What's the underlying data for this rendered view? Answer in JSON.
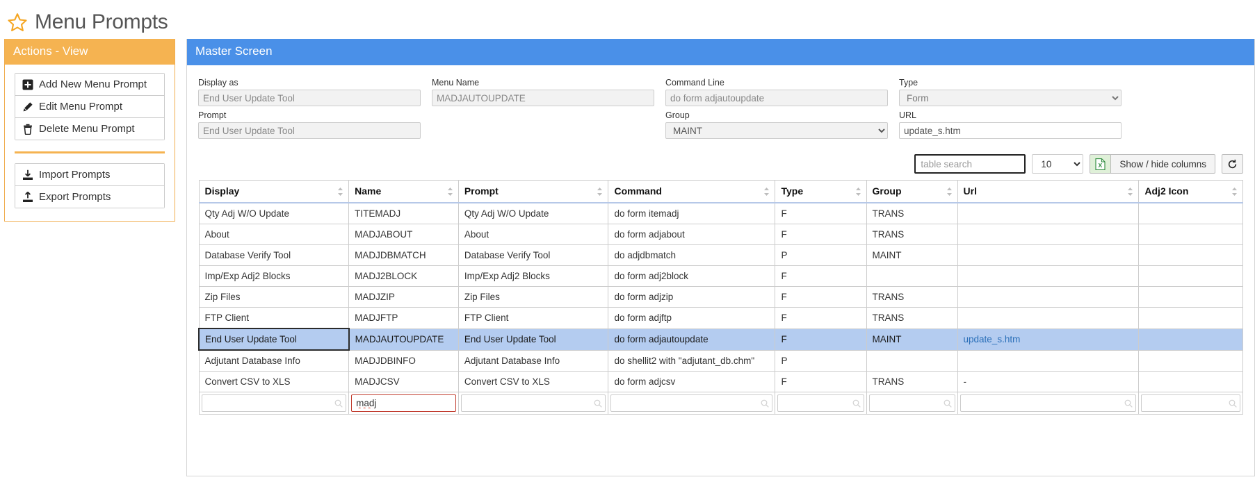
{
  "page": {
    "title": "Menu Prompts",
    "star_icon": "star-icon"
  },
  "sidebar": {
    "header": "Actions - View",
    "primary_buttons": [
      {
        "label": "Add New Menu Prompt",
        "icon": "plus-square-icon"
      },
      {
        "label": "Edit Menu Prompt",
        "icon": "pencil-icon"
      },
      {
        "label": "Delete Menu Prompt",
        "icon": "trash-icon"
      }
    ],
    "secondary_buttons": [
      {
        "label": "Import Prompts",
        "icon": "download-icon"
      },
      {
        "label": "Export Prompts",
        "icon": "upload-icon"
      }
    ]
  },
  "main": {
    "header": "Master Screen",
    "form": {
      "display_as": {
        "label": "Display as",
        "value": "End User Update Tool"
      },
      "menu_name": {
        "label": "Menu Name",
        "value": "MADJAUTOUPDATE"
      },
      "command_line": {
        "label": "Command Line",
        "value": "do form adjautoupdate"
      },
      "type": {
        "label": "Type",
        "value": "Form"
      },
      "prompt": {
        "label": "Prompt",
        "value": "End User Update Tool"
      },
      "group": {
        "label": "Group",
        "value": "MAINT"
      },
      "url": {
        "label": "URL",
        "value": "update_s.htm"
      }
    },
    "toolbar": {
      "search_placeholder": "table search",
      "search_value": "",
      "page_length": "10",
      "export_icon": "excel-icon",
      "columns_label": "Show / hide columns",
      "reset_icon": "reset-icon"
    },
    "table": {
      "columns": [
        {
          "key": "display",
          "label": "Display"
        },
        {
          "key": "name",
          "label": "Name"
        },
        {
          "key": "prompt",
          "label": "Prompt"
        },
        {
          "key": "command",
          "label": "Command"
        },
        {
          "key": "type",
          "label": "Type"
        },
        {
          "key": "group",
          "label": "Group"
        },
        {
          "key": "url",
          "label": "Url"
        },
        {
          "key": "adj2icon",
          "label": "Adj2 Icon"
        }
      ],
      "rows": [
        {
          "display": "Qty Adj W/O Update",
          "name": "TITEMADJ",
          "prompt": "Qty Adj W/O Update",
          "command": "do form itemadj",
          "type": "F",
          "group": "TRANS",
          "url": "",
          "adj2icon": "",
          "selected": false
        },
        {
          "display": "About",
          "name": "MADJABOUT",
          "prompt": "About",
          "command": "do form adjabout",
          "type": "F",
          "group": "TRANS",
          "url": "",
          "adj2icon": "",
          "selected": false
        },
        {
          "display": "Database Verify Tool",
          "name": "MADJDBMATCH",
          "prompt": "Database Verify Tool",
          "command": "do adjdbmatch",
          "type": "P",
          "group": "MAINT",
          "url": "",
          "adj2icon": "",
          "selected": false
        },
        {
          "display": "Imp/Exp Adj2 Blocks",
          "name": "MADJ2BLOCK",
          "prompt": "Imp/Exp Adj2 Blocks",
          "command": "do form adj2block",
          "type": "F",
          "group": "",
          "url": "",
          "adj2icon": "",
          "selected": false
        },
        {
          "display": "Zip Files",
          "name": "MADJZIP",
          "prompt": "Zip Files",
          "command": "do form adjzip",
          "type": "F",
          "group": "TRANS",
          "url": "",
          "adj2icon": "",
          "selected": false
        },
        {
          "display": "FTP Client",
          "name": "MADJFTP",
          "prompt": "FTP Client",
          "command": "do form adjftp",
          "type": "F",
          "group": "TRANS",
          "url": "",
          "adj2icon": "",
          "selected": false
        },
        {
          "display": "End User Update Tool",
          "name": "MADJAUTOUPDATE",
          "prompt": "End User Update Tool",
          "command": "do form adjautoupdate",
          "type": "F",
          "group": "MAINT",
          "url": "update_s.htm",
          "adj2icon": "",
          "selected": true
        },
        {
          "display": "Adjutant Database Info",
          "name": "MADJDBINFO",
          "prompt": "Adjutant Database Info",
          "command": "do shellit2 with \"adjutant_db.chm\"",
          "type": "P",
          "group": "",
          "url": "",
          "adj2icon": "",
          "selected": false
        },
        {
          "display": "Convert CSV to XLS",
          "name": "MADJCSV",
          "prompt": "Convert CSV to XLS",
          "command": "do form adjcsv",
          "type": "F",
          "group": "TRANS",
          "url": "-",
          "adj2icon": "",
          "selected": false
        }
      ],
      "filters": [
        {
          "key": "display",
          "value": "",
          "focused": false
        },
        {
          "key": "name",
          "value": "madj",
          "focused": true
        },
        {
          "key": "prompt",
          "value": "",
          "focused": false
        },
        {
          "key": "command",
          "value": "",
          "focused": false
        },
        {
          "key": "type",
          "value": "",
          "focused": false
        },
        {
          "key": "group",
          "value": "",
          "focused": false
        },
        {
          "key": "url",
          "value": "",
          "focused": false
        },
        {
          "key": "adj2icon",
          "value": "",
          "focused": false
        }
      ]
    }
  },
  "colors": {
    "accent_orange": "#f5b351",
    "accent_blue": "#4a90e8",
    "selection_blue": "#b4ccf0",
    "link_blue": "#2a6fb8",
    "excel_green": "#dff0d8"
  }
}
